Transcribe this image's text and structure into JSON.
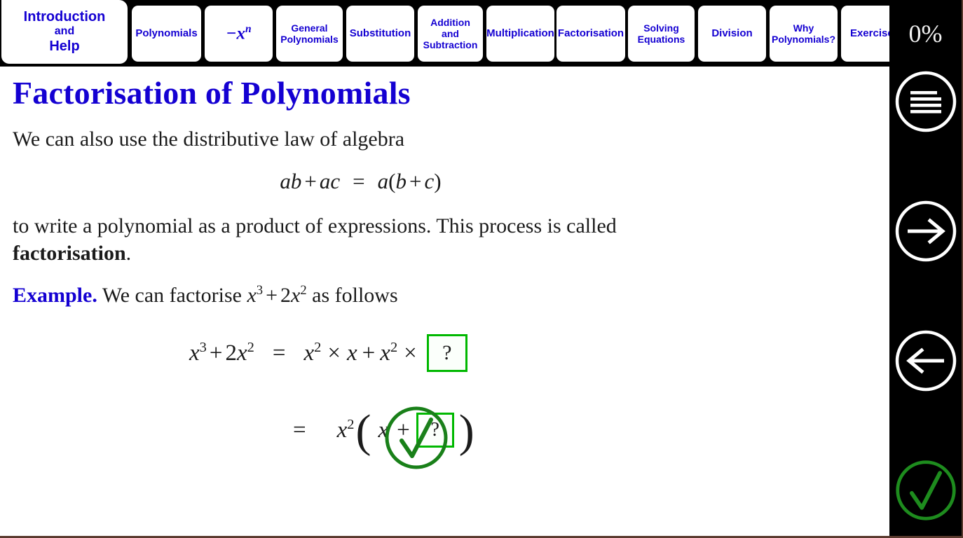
{
  "app": {
    "accent_blue": "#1400d2",
    "accent_green": "#00b800",
    "check_green": "#198019",
    "bg": "#ffffff",
    "chrome": "#000000"
  },
  "tabbar": {
    "tabs": [
      {
        "id": "introduction-and-help",
        "lines": [
          "Introduction",
          "and",
          "Help"
        ],
        "active": true,
        "type": "text"
      },
      {
        "id": "polynomials",
        "lines": [
          "Polynomials"
        ],
        "active": false,
        "type": "text"
      },
      {
        "id": "negative-x-power-n",
        "lines": [
          "−xⁿ"
        ],
        "base": "−x",
        "exponent": "n",
        "active": false,
        "type": "math"
      },
      {
        "id": "general-polynomials",
        "lines": [
          "General",
          "Polynomials"
        ],
        "active": false,
        "type": "text"
      },
      {
        "id": "substitution",
        "lines": [
          "Substitution"
        ],
        "active": false,
        "type": "text"
      },
      {
        "id": "addition-and-subtraction",
        "lines": [
          "Addition",
          "and",
          "Subtraction"
        ],
        "active": false,
        "type": "text"
      },
      {
        "id": "multiplication",
        "lines": [
          "Multiplication"
        ],
        "active": false,
        "type": "text"
      },
      {
        "id": "factorisation",
        "lines": [
          "Factorisation"
        ],
        "active": false,
        "type": "text"
      },
      {
        "id": "solving-equations",
        "lines": [
          "Solving",
          "Equations"
        ],
        "active": false,
        "type": "text"
      },
      {
        "id": "division",
        "lines": [
          "Division"
        ],
        "active": false,
        "type": "text"
      },
      {
        "id": "why-polynomials",
        "lines": [
          "Why",
          "Polynomials?"
        ],
        "active": false,
        "type": "text"
      },
      {
        "id": "exercises",
        "lines": [
          "Exercises"
        ],
        "active": false,
        "type": "text"
      }
    ]
  },
  "content": {
    "title": "Factorisation of Polynomials",
    "paragraph_1": "We can also use the distributive law of algebra",
    "display_equation": {
      "lhs": "ab + ac",
      "operator": "=",
      "rhs": "a(b + c)",
      "plain": "ab + ac = a(b + c)"
    },
    "paragraph_2_before_bold": "to write a polynomial as a product of expressions. This process is called ",
    "paragraph_2_bold": "factorisation",
    "paragraph_2_after_bold": ".",
    "example_keyword": "Example.",
    "example_text_before": "We can factorise ",
    "example_expression": "x³ + 2x²",
    "example_text_after": " as follows",
    "worked": {
      "line1": {
        "lhs_base1": "x",
        "lhs_exp1": "3",
        "lhs_plus": "+",
        "lhs_coef": "2",
        "lhs_base2": "x",
        "lhs_exp2": "2",
        "equals": "=",
        "rhs_base1": "x",
        "rhs_exp1": "2",
        "times1": "×",
        "rhs_var": "x",
        "plus": "+",
        "rhs_base2": "x",
        "rhs_exp2": "2",
        "times2": "×",
        "answer_placeholder": "?",
        "plain": "x^3 + 2x^2  =  x^2 × x + x^2 × [?]"
      },
      "line2": {
        "equals": "=",
        "factor_base": "x",
        "factor_exp": "2",
        "open_paren": "(",
        "inner_var": "x",
        "plus": "+",
        "answer_placeholder": "?",
        "close_paren": ")",
        "plain": "=  x^2 ( x + [?] )"
      }
    },
    "check_button_label": "check-answer"
  },
  "sidebar": {
    "progress_label": "0%",
    "buttons": [
      {
        "id": "menu",
        "icon": "hamburger-menu-icon",
        "color": "#ffffff"
      },
      {
        "id": "next",
        "icon": "arrow-right-icon",
        "color": "#ffffff"
      },
      {
        "id": "previous",
        "icon": "arrow-left-icon",
        "color": "#ffffff"
      },
      {
        "id": "check",
        "icon": "check-circle-icon",
        "color": "#198019"
      }
    ]
  }
}
